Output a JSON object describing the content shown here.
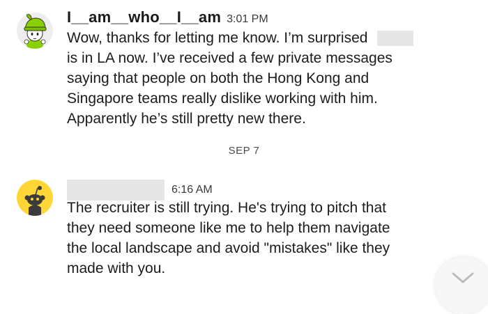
{
  "messages": [
    {
      "username": "I__am__who__I__am",
      "timestamp": "3:01 PM",
      "lines": [
        "Wow, thanks for letting me know. I’m surprised",
        "is in LA now. I’ve received a few private messages",
        "saying that people on both the Hong Kong and",
        "Singapore teams really dislike working with him.",
        "Apparently he’s still pretty new there."
      ],
      "avatar_icon": "green-hat-character-icon"
    },
    {
      "username": "",
      "timestamp": "6:16 AM",
      "lines": [
        "The recruiter is still trying. He's trying to pitch that",
        "they need someone like me to help them navigate",
        "the local landscape and avoid \"mistakes\" like they",
        "made with you."
      ],
      "avatar_icon": "reddit-snoo-icon"
    }
  ],
  "date_divider": "SEP 7",
  "colors": {
    "redaction": "#e6e6e6",
    "avatar_green": "#8bd000",
    "avatar_yellow": "#ffd635",
    "text": "#1c1c1c"
  },
  "icons": {
    "scroll_down": "chevron-down-icon"
  }
}
